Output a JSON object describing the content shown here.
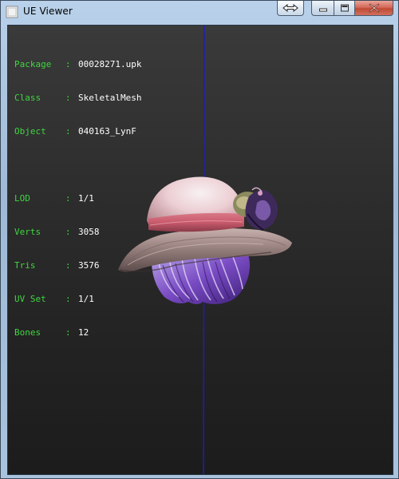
{
  "window": {
    "title": "UE Viewer",
    "icon": "ue-viewer-app-icon",
    "buttons": {
      "fullscreen_icon": "double-arrow-icon",
      "minimize_icon": "minimize-icon",
      "maximize_icon": "maximize-icon",
      "close_icon": "close-icon"
    }
  },
  "info": {
    "group1": [
      {
        "key": "Package",
        "value": "00028271.upk"
      },
      {
        "key": "Class  ",
        "value": "SkeletalMesh"
      },
      {
        "key": "Object ",
        "value": "040163_LynF"
      }
    ],
    "group2": [
      {
        "key": "LOD    ",
        "value": "1/1"
      },
      {
        "key": "Verts  ",
        "value": "3058"
      },
      {
        "key": "Tris   ",
        "value": "3576"
      },
      {
        "key": "UV Set ",
        "value": "1/1"
      },
      {
        "key": "Bones  ",
        "value": "12"
      }
    ]
  },
  "colors": {
    "label": "#3fd63f",
    "value": "#ffffff",
    "axis": "#1e1eb4",
    "background_top": "#3a3a3a",
    "background_bottom": "#1c1c1c"
  },
  "scene": {
    "model": "hat-with-hair-mesh"
  }
}
